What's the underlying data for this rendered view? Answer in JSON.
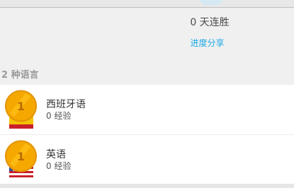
{
  "profile": {
    "streak_text": "0 天连胜",
    "share_link": "进度分享"
  },
  "languages": {
    "section_title": "2 种语言",
    "items": [
      {
        "name": "西班牙语",
        "xp": "0 经验",
        "level": "1",
        "flag": "spain-flag-icon"
      },
      {
        "name": "英语",
        "xp": "0 经验",
        "level": "1",
        "flag": "us-flag-icon"
      }
    ]
  },
  "colors": {
    "accent": "#1ca9e6",
    "medal": "#f5a800",
    "medal_dark": "#d98700"
  }
}
